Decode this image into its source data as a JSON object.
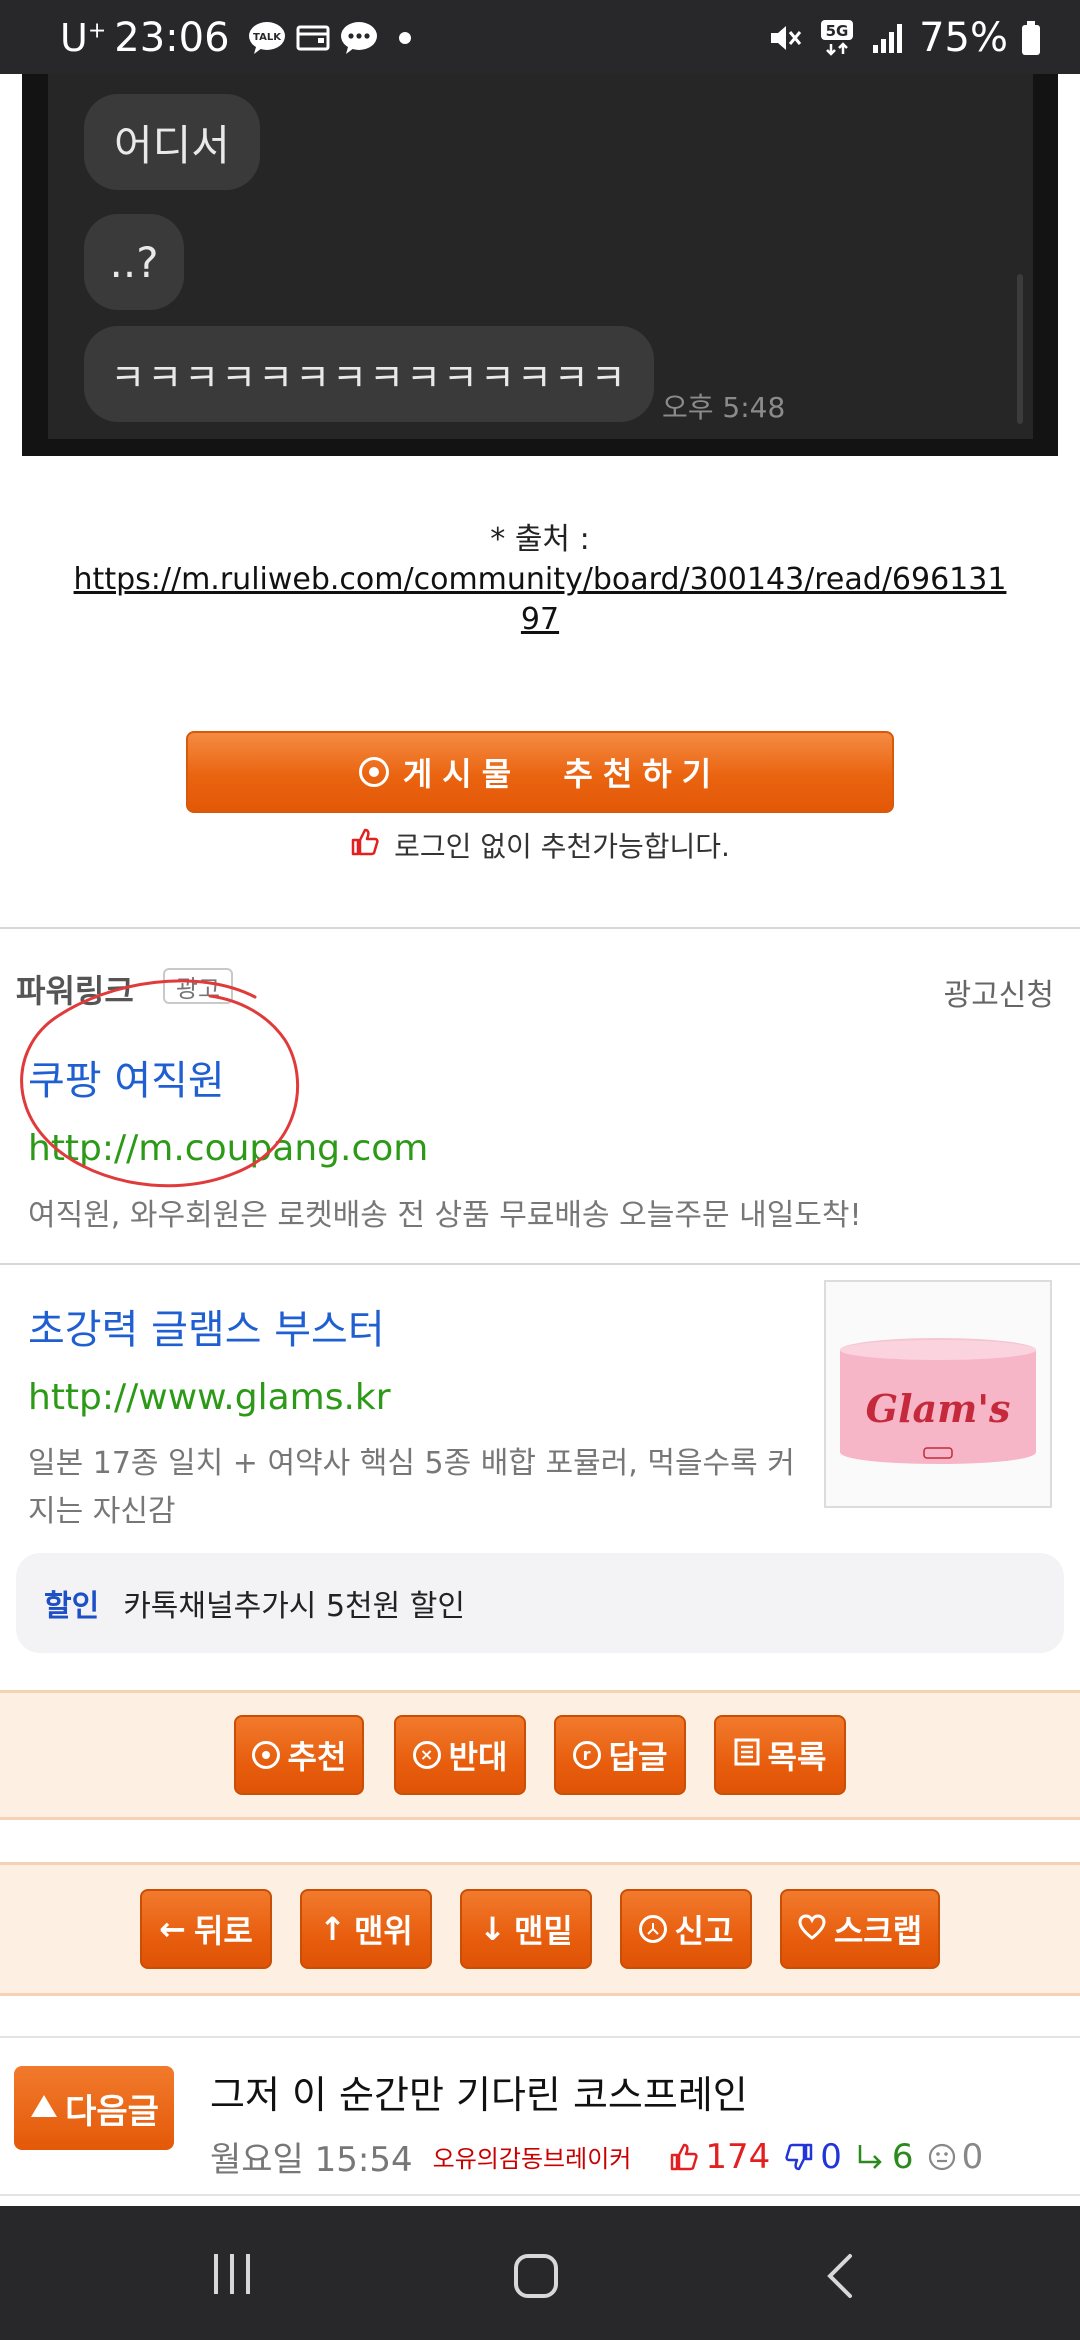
{
  "status_bar": {
    "carrier": "U",
    "carrier_sup": "+",
    "time": "23:06",
    "network": "5G",
    "battery": "75%"
  },
  "chat_screenshot": {
    "bubbles": [
      "어디서",
      "..?",
      "ㅋㅋㅋㅋㅋㅋㅋㅋㅋㅋㅋㅋㅋㅋ"
    ],
    "time": "오후 5:48"
  },
  "source": {
    "prefix": "* 출처 : ",
    "url_line1": "https://m.ruliweb.com/community/board/300143/read/696131",
    "url_line2": "97"
  },
  "recommend": {
    "button_label": "게시물  추천하기",
    "note": "로그인 없이 추천가능합니다."
  },
  "power_link": {
    "title": "파워링크",
    "badge": "광고",
    "apply": "광고신청",
    "ads": [
      {
        "title": "쿠팡 여직원",
        "url": "http://m.coupang.com",
        "desc": "여직원, 와우회원은 로켓배송 전 상품 무료배송 오늘주문 내일도착!"
      },
      {
        "title": "초강력 글램스 부스터",
        "url": "http://www.glams.kr",
        "desc_line1": "일본 17종 일치 + 여약사 핵심 5종 배합 포뮬러, 먹을수록 커",
        "desc_line2": "지는 자신감",
        "thumb_brand": "Glam's"
      }
    ],
    "discount": {
      "tag": "할인",
      "text": "카톡채널추가시 5천원 할인"
    }
  },
  "action_bar": {
    "buttons": [
      "추천",
      "반대",
      "답글",
      "목록"
    ]
  },
  "nav_bar_buttons": {
    "buttons": [
      "뒤로",
      "맨위",
      "맨밑",
      "신고",
      "스크랩"
    ]
  },
  "next_post": {
    "button": "다음글",
    "title": "그저 이 순간만 기다린 코스프레인",
    "date": "월요일 15:54",
    "author": "오유의감동브레이커",
    "up": "174",
    "down": "0",
    "replies": "6",
    "neutral": "0"
  },
  "colors": {
    "accent_orange": "#e85e0e",
    "ad_title": "#1f5fd1",
    "ad_url": "#2c9a17"
  }
}
